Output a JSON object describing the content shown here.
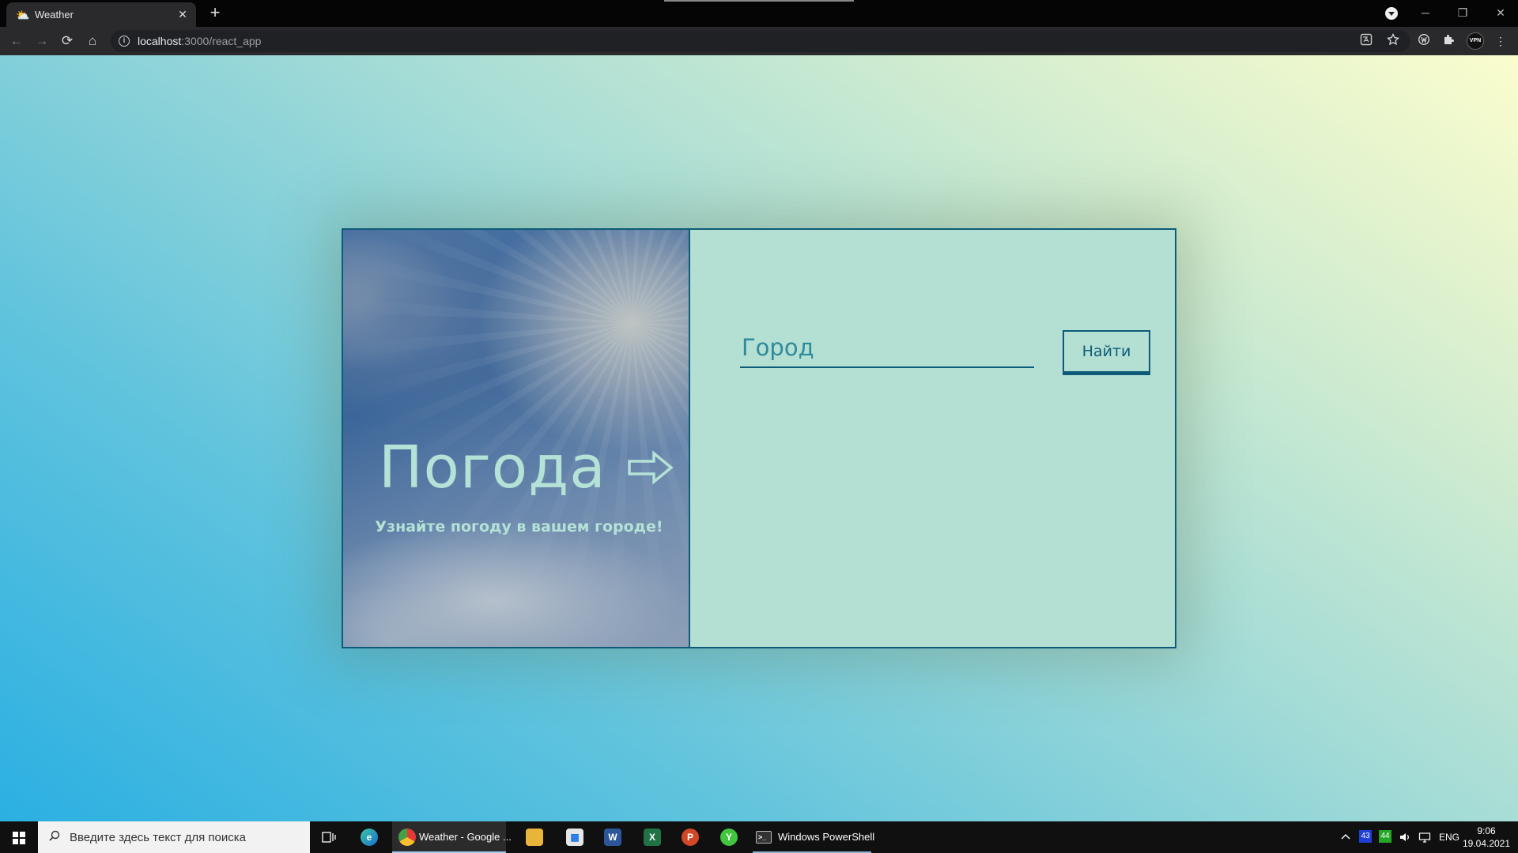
{
  "browser": {
    "tab_title": "Weather",
    "tab_favicon": "⛅",
    "tab_close": "✕",
    "new_tab": "+",
    "window_controls": {
      "minimize": "─",
      "restore": "❐",
      "close": "✕"
    },
    "url_host": "localhost",
    "url_path": ":3000/react_app",
    "nav": {
      "back": "←",
      "forward": "→",
      "reload": "⟳",
      "home": "⌂"
    },
    "icons": {
      "translate": "translate-icon",
      "bookmark": "star-icon",
      "extension": "puzzle-icon",
      "menu": "kebab-menu-icon"
    },
    "extension_avatar": "VPN"
  },
  "app": {
    "title": "Погода",
    "subtitle": "Узнайте погоду в вашем городе!",
    "city_placeholder": "Город",
    "city_value": "",
    "find_button": "Найти",
    "colors": {
      "accent": "#0d5b78",
      "card_background": "#b4dfd3",
      "hero_text": "#b4e2d6"
    }
  },
  "taskbar": {
    "search_placeholder": "Введите здесь текст для поиска",
    "apps": [
      {
        "name": "task-view",
        "label": ""
      },
      {
        "name": "edge",
        "label": ""
      },
      {
        "name": "chrome",
        "label": "Weather - Google ..."
      },
      {
        "name": "file-explorer",
        "label": ""
      },
      {
        "name": "store",
        "label": ""
      },
      {
        "name": "word",
        "label": "W"
      },
      {
        "name": "excel",
        "label": "X"
      },
      {
        "name": "powerpoint",
        "label": "P"
      },
      {
        "name": "green-app",
        "label": ""
      },
      {
        "name": "powershell",
        "label": "Windows PowerShell"
      }
    ],
    "tray": {
      "chevron": "^",
      "badge_blue": "43",
      "badge_green": "44",
      "volume": "🔊",
      "network": "▭",
      "language": "ENG"
    },
    "clock_time": "9:06",
    "clock_date": "19.04.2021"
  }
}
